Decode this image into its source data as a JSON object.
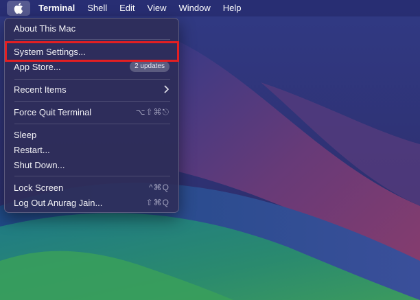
{
  "menubar": {
    "apple_icon": "apple-logo-icon",
    "items": [
      "Terminal",
      "Shell",
      "Edit",
      "View",
      "Window",
      "Help"
    ]
  },
  "apple_menu": {
    "about": "About This Mac",
    "system_settings": "System Settings...",
    "app_store": "App Store...",
    "app_store_badge": "2 updates",
    "recent_items": "Recent Items",
    "force_quit": "Force Quit Terminal",
    "force_quit_shortcut": "⌥⇧⌘⎋",
    "sleep": "Sleep",
    "restart": "Restart...",
    "shut_down": "Shut Down...",
    "lock_screen": "Lock Screen",
    "lock_screen_shortcut": "^⌘Q",
    "log_out": "Log Out Anurag Jain...",
    "log_out_shortcut": "⇧⌘Q"
  },
  "annotation": {
    "highlight_color": "#e41f22"
  }
}
